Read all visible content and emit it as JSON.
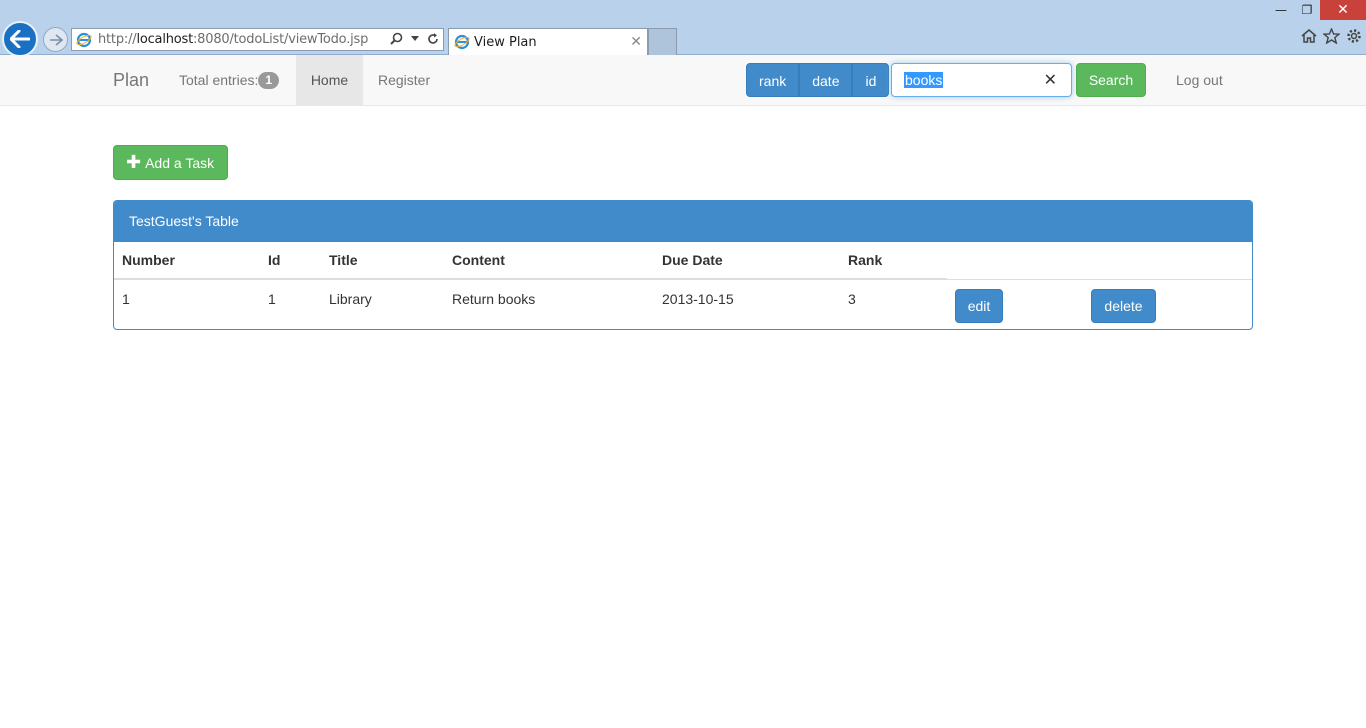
{
  "browser": {
    "url_prefix": "http://",
    "url_host": "localhost",
    "url_rest": ":8080/todoList/viewTodo.jsp",
    "tab_title": "View Plan"
  },
  "navbar": {
    "brand": "Plan",
    "total_label": "Total entries:",
    "total_count": "1",
    "home": "Home",
    "register": "Register",
    "sort_buttons": [
      "rank",
      "date",
      "id"
    ],
    "search_value": "books",
    "search_button": "Search",
    "logout": "Log out"
  },
  "content": {
    "add_task": "Add a Task",
    "table_title": "TestGuest's Table",
    "columns": [
      "Number",
      "Id",
      "Title",
      "Content",
      "Due Date",
      "Rank"
    ],
    "rows": [
      {
        "number": "1",
        "id": "1",
        "title": "Library",
        "content": "Return books",
        "due": "2013-10-15",
        "rank": "3",
        "edit": "edit",
        "delete": "delete"
      }
    ]
  },
  "colors": {
    "primary": "#428bca",
    "success": "#5cb85c",
    "chrome": "#b9d1ea"
  }
}
